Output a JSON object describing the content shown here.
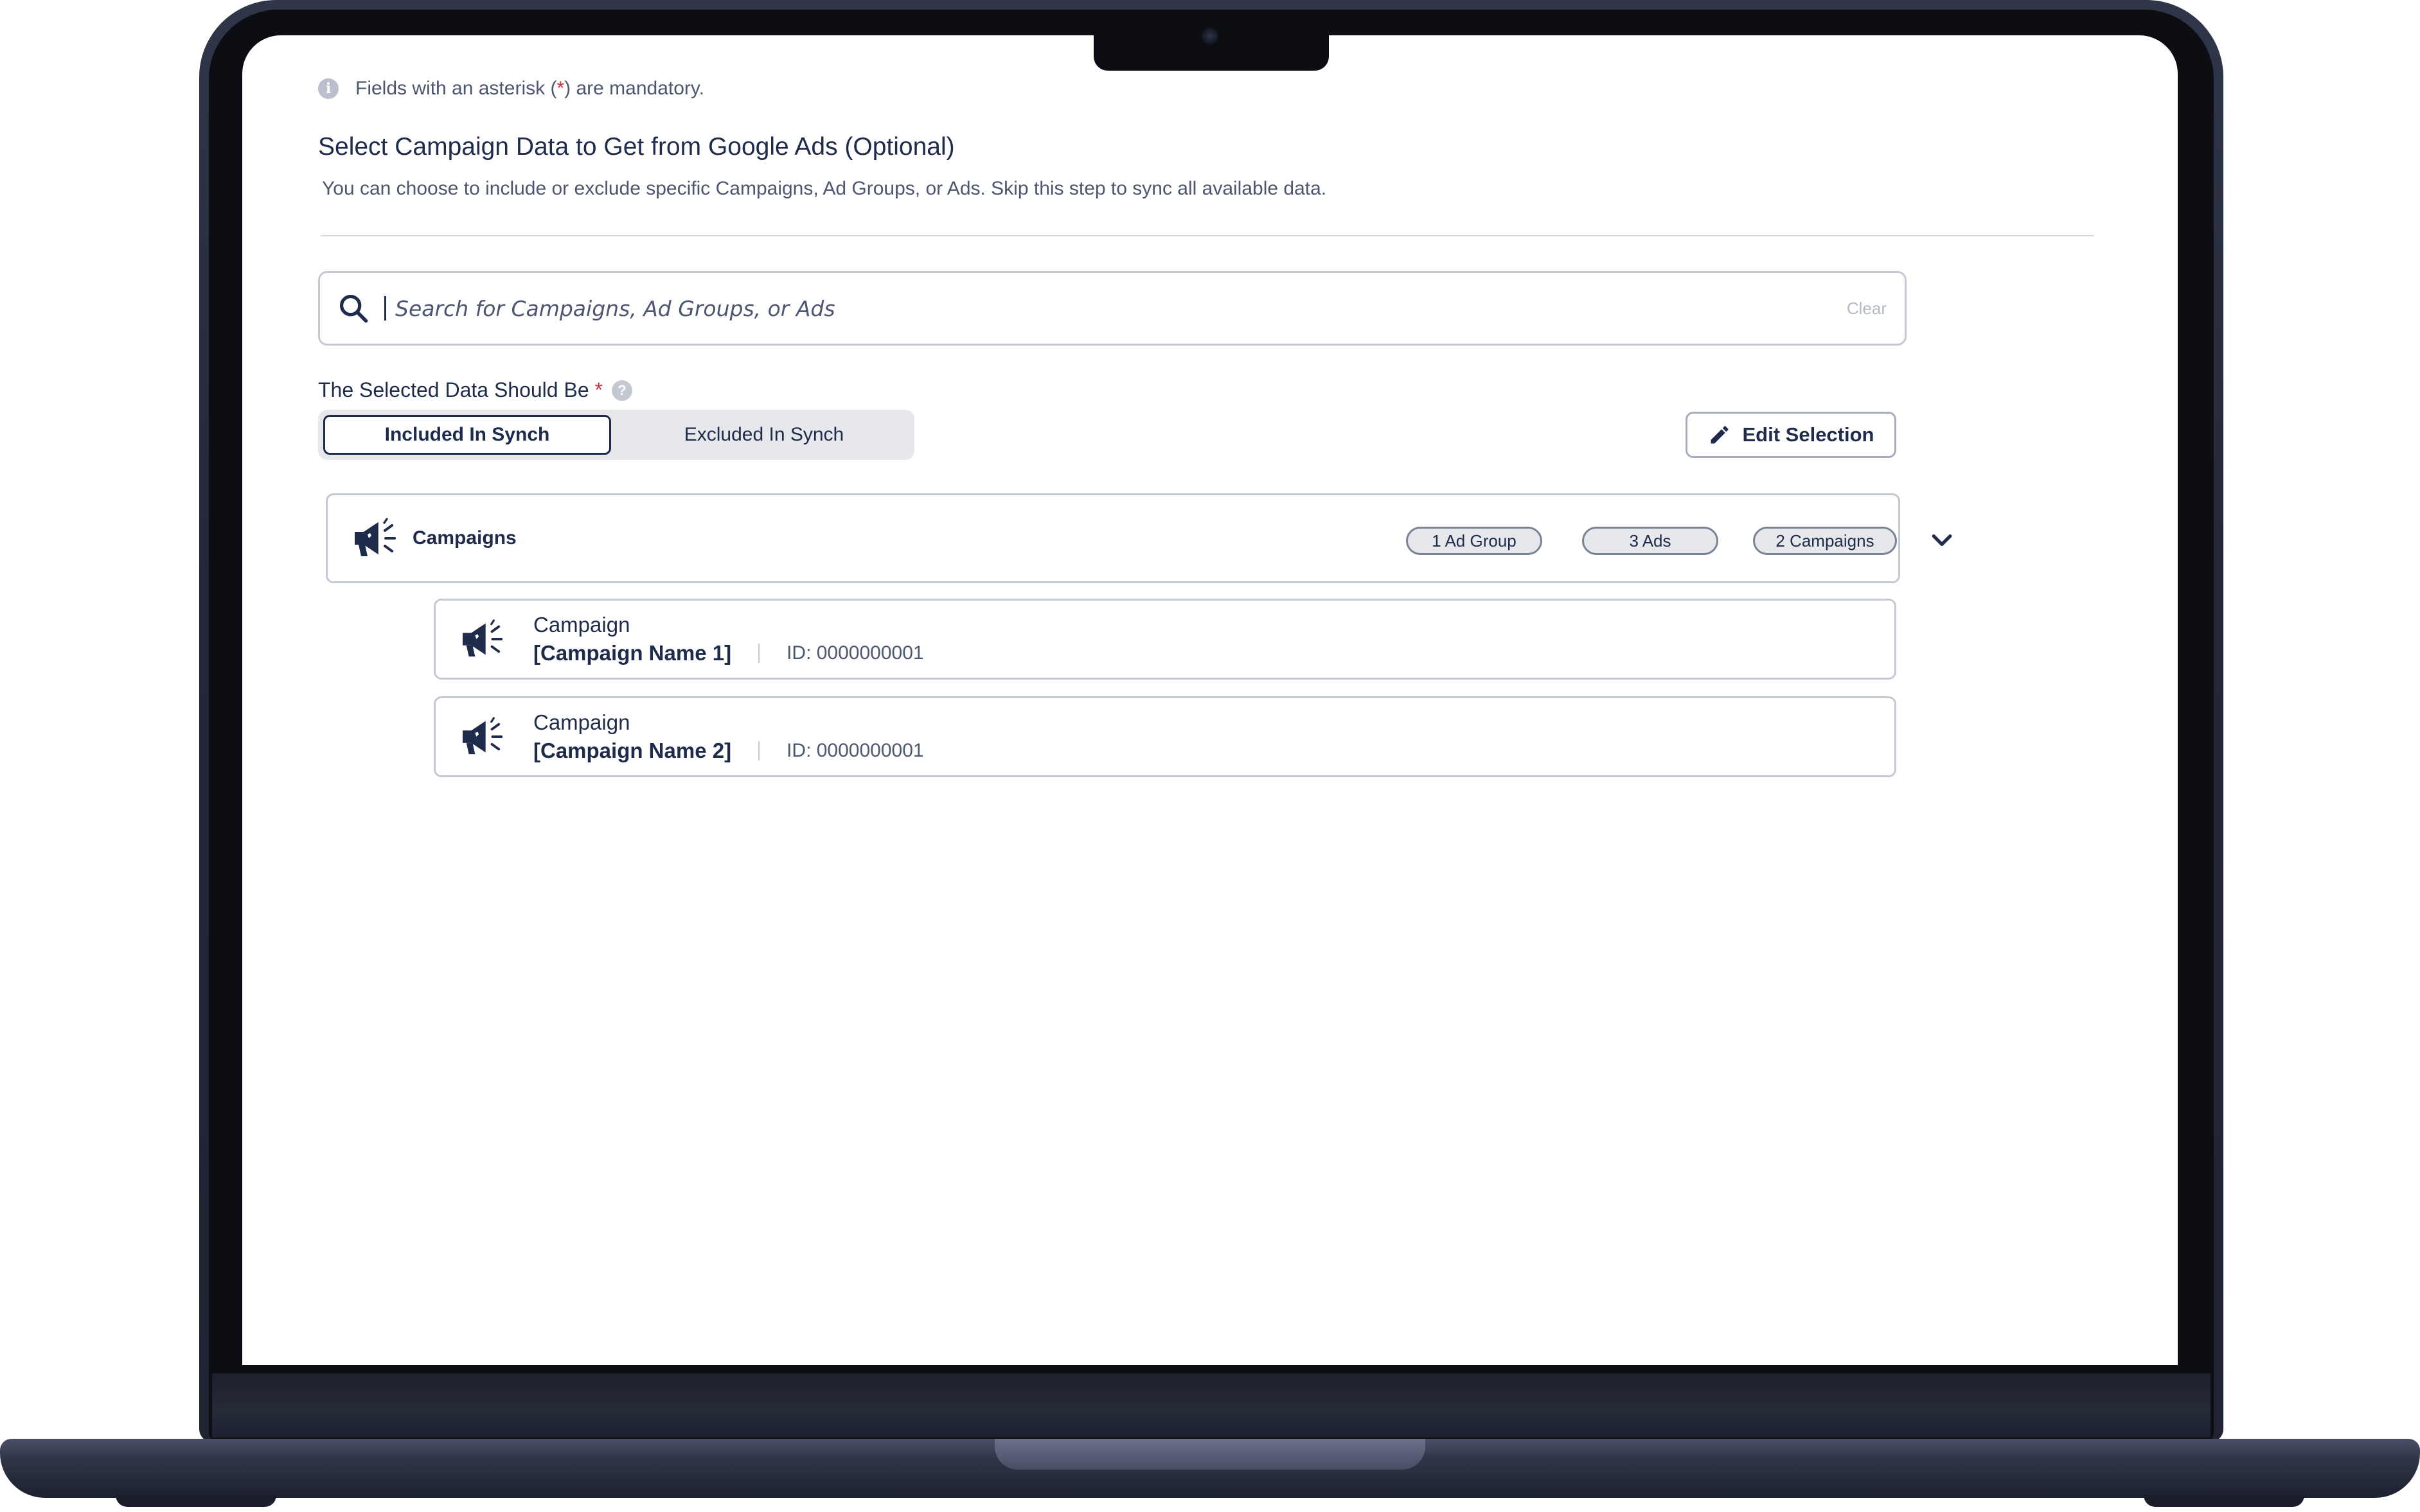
{
  "notice": {
    "prefix": "Fields with an asterisk (",
    "asterisk": "*",
    "suffix": ") are mandatory."
  },
  "section": {
    "title": "Select Campaign Data to Get from Google Ads (Optional)",
    "description": "You can choose to include or exclude specific Campaigns, Ad Groups, or Ads. Skip this step to sync all available data."
  },
  "search": {
    "placeholder": "Search for Campaigns, Ad Groups, or Ads",
    "clear_label": "Clear"
  },
  "selection": {
    "label": "The Selected Data Should Be",
    "required_mark": "*",
    "options": [
      "Included In Synch",
      "Excluded In Synch"
    ],
    "selected": "Included In Synch"
  },
  "edit_button": {
    "label": "Edit Selection"
  },
  "group": {
    "title": "Campaigns",
    "chips": [
      "1 Ad Group",
      "3 Ads",
      "2 Campaigns"
    ]
  },
  "items": [
    {
      "type": "Campaign",
      "name": "[Campaign Name 1]",
      "id": "ID: 0000000001"
    },
    {
      "type": "Campaign",
      "name": "[Campaign Name 2]",
      "id": "ID: 0000000001"
    }
  ],
  "colors": {
    "primary": "#1e2b4a",
    "muted": "#4c5670",
    "border": "#c4c8d2",
    "required": "#c4323c",
    "chip_bg": "#e6e8ec"
  },
  "icons": {
    "info": "info-icon",
    "search": "search-icon",
    "help": "question-icon",
    "edit": "pencil-icon",
    "campaign": "megaphone-icon",
    "expand": "chevron-down-icon"
  }
}
